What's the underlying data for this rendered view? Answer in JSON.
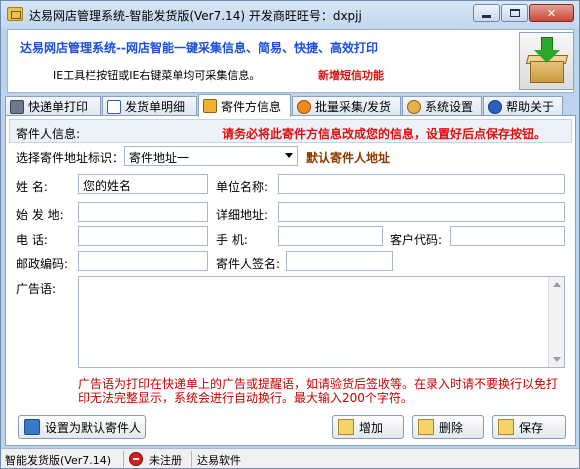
{
  "window": {
    "title": "达易网店管理系统-智能发货版(Ver7.14) 开发商旺旺号：dxpjj",
    "icon": "app-box-icon"
  },
  "banner": {
    "title": "达易网店管理系统--网店智能一键采集信息、简易、快捷、高效打印",
    "tip": "IE工具栏按钮或IE右键菜单均可采集信息。",
    "new_feature": "新增短信功能",
    "logo": "download-box-icon"
  },
  "tabs": [
    {
      "label": "快递单打印",
      "icon": "printer-icon"
    },
    {
      "label": "发货单明细",
      "icon": "document-icon"
    },
    {
      "label": "寄件方信息",
      "icon": "sender-icon"
    },
    {
      "label": "批量采集/发货",
      "icon": "batch-icon"
    },
    {
      "label": "系统设置",
      "icon": "settings-icon"
    },
    {
      "label": "帮助关于",
      "icon": "help-icon"
    }
  ],
  "active_tab": "寄件方信息",
  "sender_panel": {
    "header_label": "寄件人信息:",
    "header_warning": "请务必将此寄件方信息改成您的信息，设置好后点保存按钮。",
    "address_select_label": "选择寄件地址标识：",
    "address_select_value": "寄件地址一",
    "default_sender_text": "默认寄件人地址",
    "fields": {
      "name_label": "姓    名:",
      "name_value": "您的姓名",
      "company_label": "单位名称:",
      "company_value": "",
      "origin_label": "始 发 地:",
      "origin_value": "",
      "address_label": "详细地址:",
      "address_value": "",
      "phone_label": "电    话:",
      "phone_value": "",
      "mobile_label": "手    机:",
      "mobile_value": "",
      "customer_code_label": "客户代码:",
      "customer_code_value": "",
      "postcode_label": "邮政编码:",
      "postcode_value": "",
      "signature_label": "寄件人签名:",
      "signature_value": "",
      "ad_label": "广告语:",
      "ad_value": ""
    },
    "ad_note": "广告语为打印在快递单上的广告或提醒语，如请验货后签收等。在录入时请不要换行以免打印无法完整显示，系统会进行自动换行。最大输入200个字符。",
    "buttons": {
      "set_default": "设置为默认寄件人",
      "add": "增加",
      "delete": "删除",
      "save": "保存"
    }
  },
  "statusbar": {
    "edition": "智能发货版(Ver7.14)",
    "registration": "未注册",
    "company": "达易软件"
  },
  "colors": {
    "banner_title": "#1b4fd8",
    "warning_red": "#e01010",
    "default_sender_brown": "#8b3a00",
    "note_red": "#c80000",
    "frame_blue": "#bcd3ec"
  }
}
